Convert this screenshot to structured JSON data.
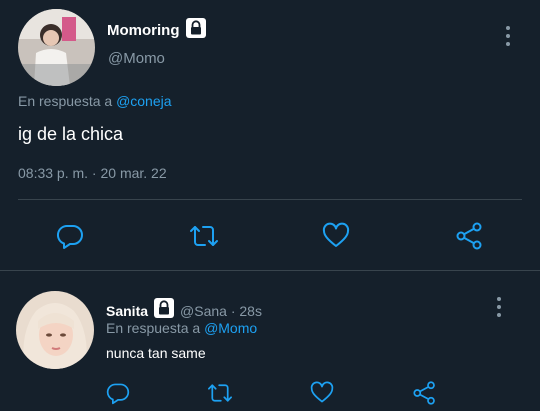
{
  "main_tweet": {
    "display_name": "Momoring",
    "handle": "@Momo",
    "reply_prefix": "En respuesta a",
    "reply_to": "@coneja",
    "text": "ig de la chica",
    "timestamp": "08:33 p. m. · 20 mar. 22"
  },
  "reply_tweet": {
    "display_name": "Sanita",
    "handle_time": "@Sana · 28s",
    "reply_prefix": "En respuesta a",
    "reply_to": "@Momo",
    "text": "nunca tan same"
  },
  "colors": {
    "background": "#15202b",
    "muted": "#8899a6",
    "accent": "#1da1f2",
    "divider": "#38444d"
  },
  "icons": [
    "lock-icon",
    "more-options-icon",
    "reply-icon",
    "retweet-icon",
    "like-icon",
    "share-icon"
  ]
}
